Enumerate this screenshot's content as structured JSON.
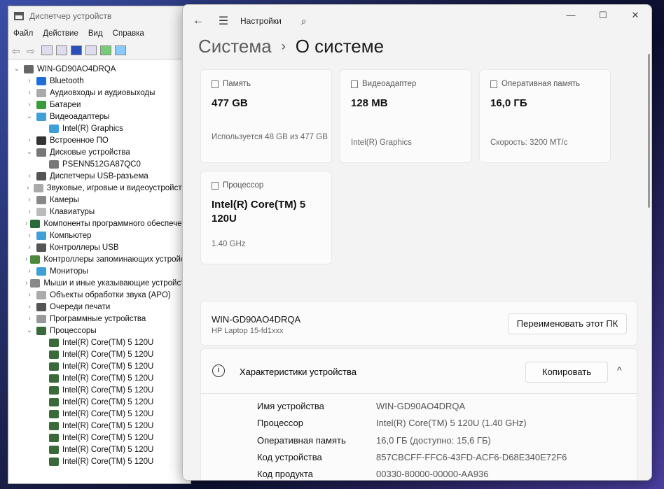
{
  "device_manager": {
    "title": "Диспетчер устройств",
    "menu": [
      "Файл",
      "Действие",
      "Вид",
      "Справка"
    ],
    "tree": [
      {
        "label": "WIN-GD90AO4DRQA",
        "level": 0,
        "state": "open",
        "icon_color": "#666"
      },
      {
        "label": "Bluetooth",
        "level": 1,
        "state": "closed",
        "icon_color": "#1e6fd9"
      },
      {
        "label": "Аудиовходы и аудиовыходы",
        "level": 1,
        "state": "closed",
        "icon_color": "#aaa"
      },
      {
        "label": "Батареи",
        "level": 1,
        "state": "closed",
        "icon_color": "#3a9b3a"
      },
      {
        "label": "Видеоадаптеры",
        "level": 1,
        "state": "open",
        "icon_color": "#3fa0d8"
      },
      {
        "label": "Intel(R) Graphics",
        "level": 2,
        "state": "none",
        "icon_color": "#3fa0d8"
      },
      {
        "label": "Встроенное ПО",
        "level": 1,
        "state": "closed",
        "icon_color": "#333"
      },
      {
        "label": "Дисковые устройства",
        "level": 1,
        "state": "open",
        "icon_color": "#777"
      },
      {
        "label": "PSENN512GA87QC0",
        "level": 2,
        "state": "none",
        "icon_color": "#777"
      },
      {
        "label": "Диспетчеры USB-разъема",
        "level": 1,
        "state": "closed",
        "icon_color": "#555"
      },
      {
        "label": "Звуковые, игровые и видеоустройства",
        "level": 1,
        "state": "closed",
        "icon_color": "#aaa"
      },
      {
        "label": "Камеры",
        "level": 1,
        "state": "closed",
        "icon_color": "#888"
      },
      {
        "label": "Клавиатуры",
        "level": 1,
        "state": "closed",
        "icon_color": "#bbb"
      },
      {
        "label": "Компоненты программного обеспечения",
        "level": 1,
        "state": "closed",
        "icon_color": "#2a6a3a"
      },
      {
        "label": "Компьютер",
        "level": 1,
        "state": "closed",
        "icon_color": "#3fa0d8"
      },
      {
        "label": "Контроллеры USB",
        "level": 1,
        "state": "closed",
        "icon_color": "#555"
      },
      {
        "label": "Контроллеры запоминающих устройств",
        "level": 1,
        "state": "closed",
        "icon_color": "#4a8a3a"
      },
      {
        "label": "Мониторы",
        "level": 1,
        "state": "closed",
        "icon_color": "#3fa0d8"
      },
      {
        "label": "Мыши и иные указывающие устройства",
        "level": 1,
        "state": "closed",
        "icon_color": "#888"
      },
      {
        "label": "Объекты обработки звука (APO)",
        "level": 1,
        "state": "closed",
        "icon_color": "#aaa"
      },
      {
        "label": "Очереди печати",
        "level": 1,
        "state": "closed",
        "icon_color": "#555"
      },
      {
        "label": "Программные устройства",
        "level": 1,
        "state": "closed",
        "icon_color": "#999"
      },
      {
        "label": "Процессоры",
        "level": 1,
        "state": "open",
        "icon_color": "#3a6a3a"
      },
      {
        "label": "Intel(R) Core(TM) 5 120U",
        "level": 2,
        "state": "none",
        "icon_color": "#3a6a3a"
      },
      {
        "label": "Intel(R) Core(TM) 5 120U",
        "level": 2,
        "state": "none",
        "icon_color": "#3a6a3a"
      },
      {
        "label": "Intel(R) Core(TM) 5 120U",
        "level": 2,
        "state": "none",
        "icon_color": "#3a6a3a"
      },
      {
        "label": "Intel(R) Core(TM) 5 120U",
        "level": 2,
        "state": "none",
        "icon_color": "#3a6a3a"
      },
      {
        "label": "Intel(R) Core(TM) 5 120U",
        "level": 2,
        "state": "none",
        "icon_color": "#3a6a3a"
      },
      {
        "label": "Intel(R) Core(TM) 5 120U",
        "level": 2,
        "state": "none",
        "icon_color": "#3a6a3a"
      },
      {
        "label": "Intel(R) Core(TM) 5 120U",
        "level": 2,
        "state": "none",
        "icon_color": "#3a6a3a"
      },
      {
        "label": "Intel(R) Core(TM) 5 120U",
        "level": 2,
        "state": "none",
        "icon_color": "#3a6a3a"
      },
      {
        "label": "Intel(R) Core(TM) 5 120U",
        "level": 2,
        "state": "none",
        "icon_color": "#3a6a3a"
      },
      {
        "label": "Intel(R) Core(TM) 5 120U",
        "level": 2,
        "state": "none",
        "icon_color": "#3a6a3a"
      },
      {
        "label": "Intel(R) Core(TM) 5 120U",
        "level": 2,
        "state": "none",
        "icon_color": "#3a6a3a"
      }
    ]
  },
  "settings": {
    "app_title": "Настройки",
    "breadcrumb": {
      "parent": "Система",
      "current": "О системе"
    },
    "cards": [
      {
        "label": "Память",
        "value": "477 GB",
        "sub": "Используется 48 GB из 477 GB"
      },
      {
        "label": "Видеоадаптер",
        "value": "128 MB",
        "sub": "Intel(R) Graphics"
      },
      {
        "label": "Оперативная память",
        "value": "16,0 ГБ",
        "sub": "Скорость: 3200 MT/с"
      },
      {
        "label": "Процессор",
        "value": "Intel(R) Core(TM) 5 120U",
        "sub": "1.40 GHz"
      }
    ],
    "pc": {
      "name": "WIN-GD90AO4DRQA",
      "model": "HP Laptop 15-fd1xxx",
      "rename": "Переименовать этот ПК"
    },
    "specs": {
      "title": "Характеристики устройства",
      "copy": "Копировать",
      "rows": [
        {
          "k": "Имя устройства",
          "v": "WIN-GD90AO4DRQA"
        },
        {
          "k": "Процессор",
          "v": "Intel(R) Core(TM) 5 120U (1.40 GHz)"
        },
        {
          "k": "Оперативная память",
          "v": "16,0 ГБ (доступно: 15,6 ГБ)"
        },
        {
          "k": "Код устройства",
          "v": "857CBCFF-FFC6-43FD-ACF6-D68E340E72F6"
        },
        {
          "k": "Код продукта",
          "v": "00330-80000-00000-AA936"
        }
      ]
    }
  }
}
